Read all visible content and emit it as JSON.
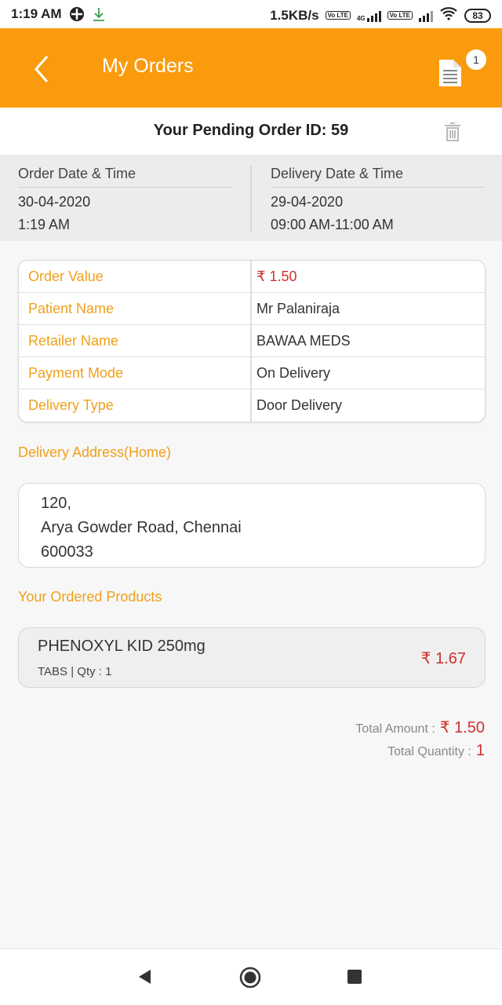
{
  "status_bar": {
    "time": "1:19 AM",
    "speed": "1.5KB/s",
    "network_4g": "4G",
    "volte": "Vo LTE",
    "battery": "83"
  },
  "header": {
    "title": "My Orders",
    "orders_badge": "1"
  },
  "order": {
    "pending_title": "Your Pending Order ID: 59",
    "order_dt_label": "Order Date & Time",
    "order_date": "30-04-2020",
    "order_time": "1:19 AM",
    "delivery_dt_label": "Delivery Date & Time",
    "delivery_date": "29-04-2020",
    "delivery_time": "09:00 AM-11:00 AM"
  },
  "details": [
    {
      "label": "Order Value",
      "value": "₹ 1.50"
    },
    {
      "label": "Patient Name",
      "value": "Mr Palaniraja"
    },
    {
      "label": "Retailer Name",
      "value": "BAWAA MEDS"
    },
    {
      "label": "Payment Mode",
      "value": "On Delivery"
    },
    {
      "label": "Delivery Type",
      "value": "Door Delivery"
    }
  ],
  "address": {
    "label": "Delivery Address(Home)",
    "line1": "120,",
    "line2": "Arya Gowder Road, Chennai",
    "line3": "600033"
  },
  "products": {
    "label": "Your Ordered Products",
    "items": [
      {
        "name": "PHENOXYL KID 250mg",
        "meta": "TABS | Qty : 1",
        "price": "₹ 1.67"
      }
    ]
  },
  "totals": {
    "amount_label": "Total Amount :",
    "amount_value": "₹ 1.50",
    "qty_label": "Total Quantity :",
    "qty_value": "1"
  },
  "colors": {
    "accent": "#fa9b0d",
    "label": "#f0a01a",
    "price": "#d32f2f"
  }
}
